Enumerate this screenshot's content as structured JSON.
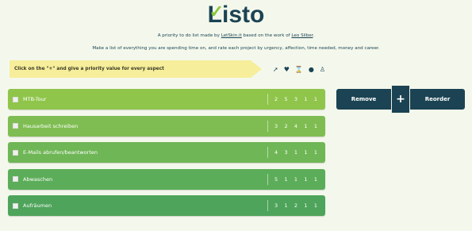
{
  "header": {
    "logo_text": "Listo",
    "byline_prefix": "A priority to do list made by ",
    "byline_link1": "LetSkin.it",
    "byline_middle": " based on the work of ",
    "byline_link2": "Leo Silber",
    "byline_suffix": ".",
    "tagline": "Make a list of everything you are spending time on, and rate each project by urgency, affection, time needed, money and career."
  },
  "notice": {
    "text": "Click on the \"+\" and give a priority value for every aspect"
  },
  "aspect_icons": [
    "pin-icon",
    "heart-icon",
    "hourglass-icon",
    "money-bag-icon",
    "career-icon"
  ],
  "tasks": [
    {
      "name": "MTB-Tour",
      "scores": [
        "2",
        "5",
        "3",
        "1",
        "1"
      ],
      "color": "#8fc54b"
    },
    {
      "name": "Hausarbeit schreiben",
      "scores": [
        "3",
        "2",
        "4",
        "1",
        "1"
      ],
      "color": "#7fbd52"
    },
    {
      "name": "E-Mails abrufen/beantworten",
      "scores": [
        "4",
        "3",
        "1",
        "1",
        "1"
      ],
      "color": "#6fb656"
    },
    {
      "name": "Abwaschen",
      "scores": [
        "5",
        "1",
        "1",
        "1",
        "1"
      ],
      "color": "#5cad59"
    },
    {
      "name": "Aufräumen",
      "scores": [
        "3",
        "1",
        "2",
        "1",
        "1"
      ],
      "color": "#4ea45a"
    }
  ],
  "actions": {
    "remove_label": "Remove",
    "add_label": "+",
    "reorder_label": "Reorder",
    "color": "#1b4353"
  }
}
